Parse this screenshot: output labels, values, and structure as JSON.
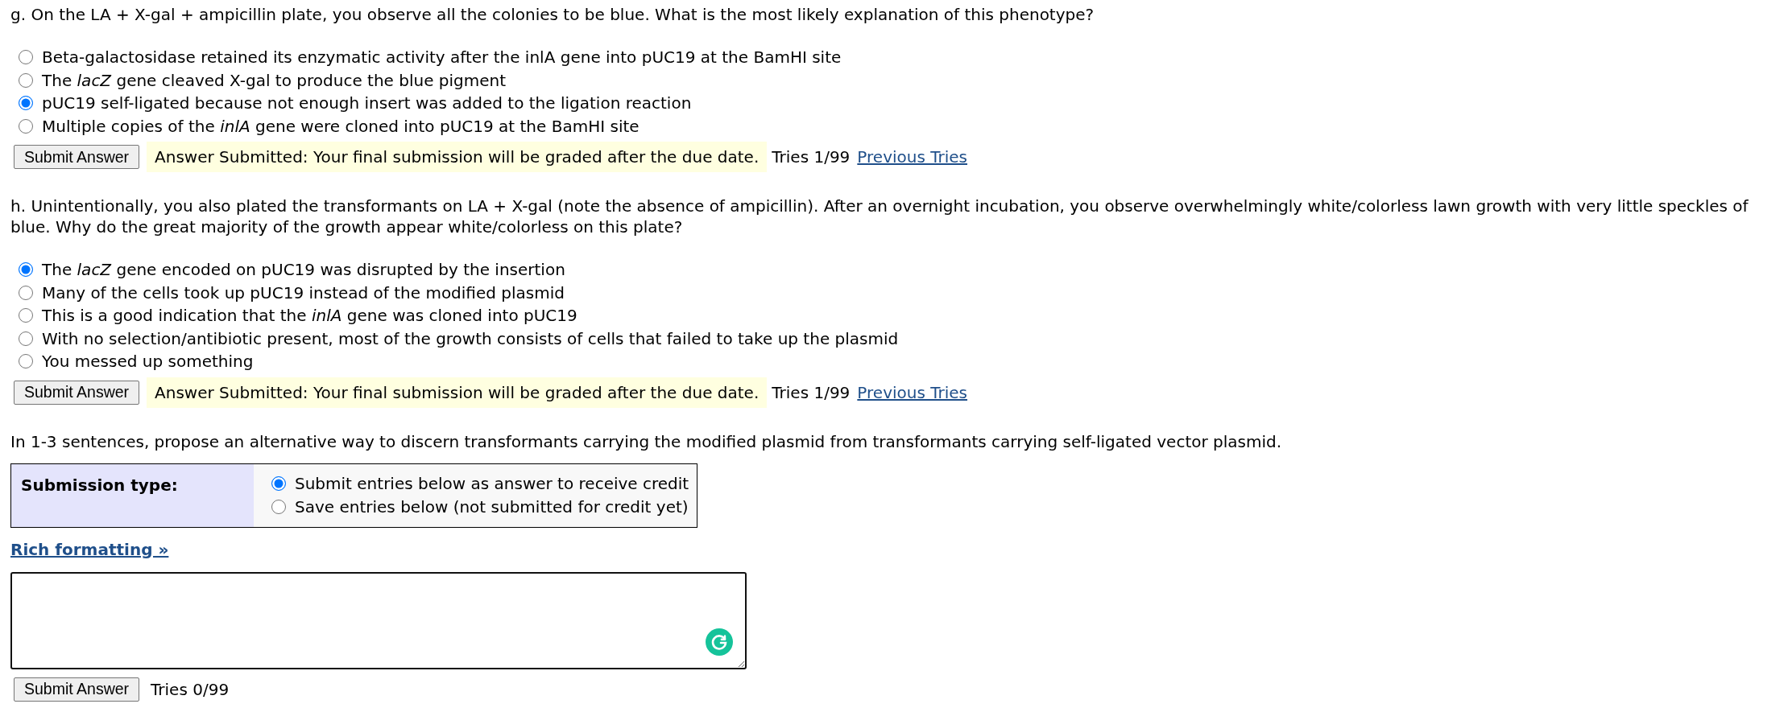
{
  "questions": [
    {
      "prompt": "g. On the LA + X-gal + ampicillin plate, you observe all the colonies to be blue. What is the most likely explanation of this phenotype?",
      "options": [
        {
          "label": "Beta-galactosidase retained its enzymatic activity after the inlA gene into pUC19 at the BamHI site",
          "selected": false
        },
        {
          "label": "The *lacZ* gene cleaved X-gal to produce the blue pigment",
          "selected": false
        },
        {
          "label": "pUC19 self-ligated because not enough insert was added to the ligation reaction",
          "selected": true
        },
        {
          "label": "Multiple copies of the *inlA* gene were cloned into pUC19 at the BamHI site",
          "selected": false
        }
      ],
      "submit_button": "Submit Answer",
      "status": "Answer Submitted: Your final submission will be graded after the due date.",
      "tries": "Tries 1/99",
      "previous_tries_link": "Previous Tries"
    },
    {
      "prompt": "h. Unintentionally, you also plated the transformants on LA + X-gal (note the absence of ampicillin). After an overnight incubation, you observe overwhelmingly white/colorless lawn growth with very little speckles of blue. Why do the great majority of the growth appear white/colorless on this plate?",
      "options": [
        {
          "label": "The *lacZ* gene encoded on pUC19 was disrupted by the insertion",
          "selected": true
        },
        {
          "label": "Many of the cells took up pUC19 instead of the modified plasmid",
          "selected": false
        },
        {
          "label": "This is a good indication that the *inlA* gene was cloned into pUC19",
          "selected": false
        },
        {
          "label": "With no selection/antibiotic present, most of the growth consists of cells that failed to take up the plasmid",
          "selected": false
        },
        {
          "label": "You messed up something",
          "selected": false
        }
      ],
      "submit_button": "Submit Answer",
      "status": "Answer Submitted: Your final submission will be graded after the due date.",
      "tries": "Tries 1/99",
      "previous_tries_link": "Previous Tries"
    }
  ],
  "free_response": {
    "prompt": "In 1-3 sentences, propose an alternative way to discern transformants carrying the modified plasmid from transformants carrying self-ligated vector plasmid.",
    "submission_type": {
      "label": "Submission type:",
      "options": [
        {
          "label": "Submit entries below as answer to receive credit",
          "selected": true
        },
        {
          "label": "Save entries below (not submitted for credit yet)",
          "selected": false
        }
      ]
    },
    "rich_formatting_link": "Rich formatting »",
    "submit_button": "Submit Answer",
    "tries": "Tries 0/99"
  }
}
